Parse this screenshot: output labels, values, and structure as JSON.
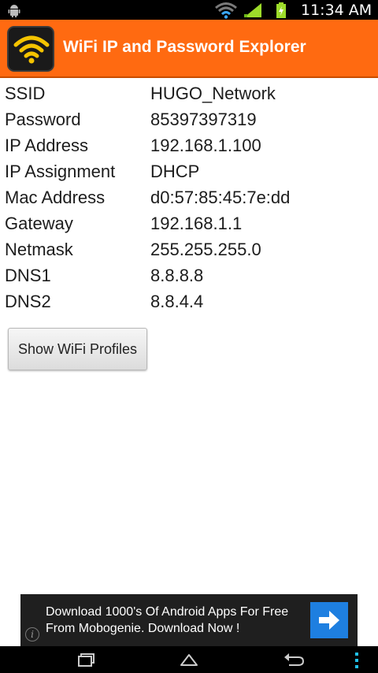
{
  "status_bar": {
    "time": "11:34 AM"
  },
  "app": {
    "title": "WiFi IP and Password Explorer",
    "accent_color": "#ff6a11"
  },
  "wifi_info": [
    {
      "label": "SSID",
      "value": "HUGO_Network"
    },
    {
      "label": "Password",
      "value": "85397397319"
    },
    {
      "label": "IP Address",
      "value": "192.168.1.100"
    },
    {
      "label": "IP Assignment",
      "value": "DHCP"
    },
    {
      "label": "Mac Address",
      "value": "d0:57:85:45:7e:dd"
    },
    {
      "label": "Gateway",
      "value": "192.168.1.1"
    },
    {
      "label": "Netmask",
      "value": "255.255.255.0"
    },
    {
      "label": "DNS1",
      "value": "8.8.8.8"
    },
    {
      "label": "DNS2",
      "value": "8.8.4.4"
    }
  ],
  "profiles_button": {
    "label": "Show WiFi Profiles"
  },
  "ad": {
    "line1": "Download 1000's Of Android Apps For Free",
    "line2": "From Mobogenie. Download Now !",
    "info_glyph": "i",
    "arrow_color": "#1e7fe0"
  },
  "icons": {
    "status": [
      "android-icon",
      "wifi-icon",
      "signal-icon",
      "battery-icon"
    ],
    "nav": [
      "recent-apps-icon",
      "home-icon",
      "back-icon",
      "menu-icon"
    ]
  }
}
